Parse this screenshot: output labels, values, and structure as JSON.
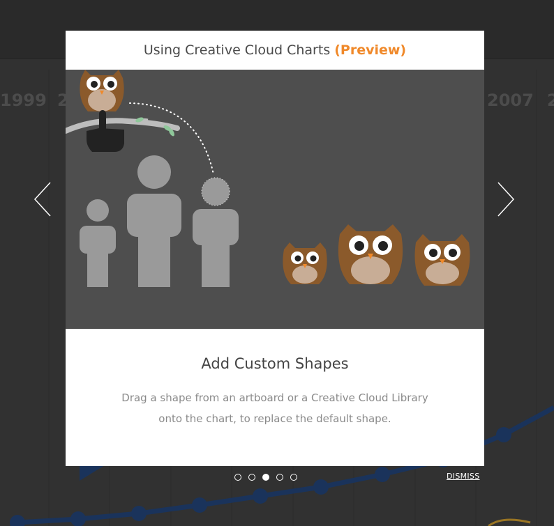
{
  "background": {
    "years": [
      {
        "label": "1999"
      },
      {
        "label": "2"
      },
      {
        "label": "2007"
      },
      {
        "label": "2"
      }
    ],
    "line_color": "#1f3d6b"
  },
  "modal": {
    "title": "Using Creative Cloud Charts",
    "title_tag": "(Preview)",
    "slide_title": "Add Custom Shapes",
    "slide_description": "Drag a shape from an artboard or a Creative Cloud Library onto the chart, to replace the default shape.",
    "accent_color": "#f0892a"
  },
  "navigation": {
    "prev_icon": "chevron-left-icon",
    "next_icon": "chevron-right-icon",
    "pages": [
      {
        "active": false
      },
      {
        "active": false
      },
      {
        "active": true
      },
      {
        "active": false
      },
      {
        "active": false
      }
    ],
    "dismiss_label": "DISMISS"
  }
}
